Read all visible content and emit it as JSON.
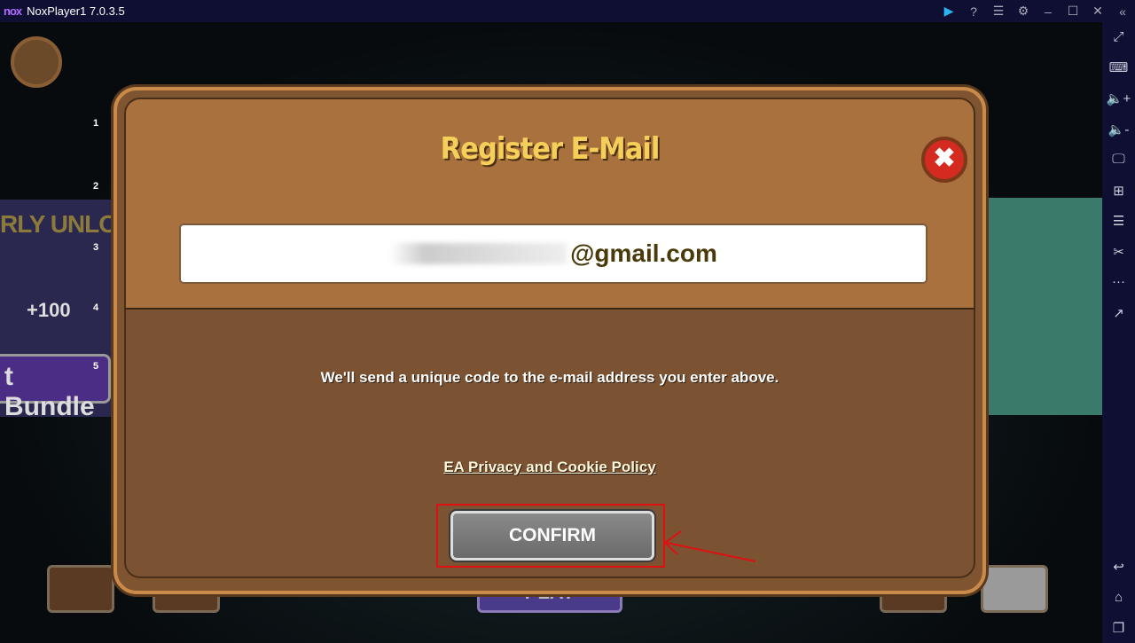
{
  "titlebar": {
    "logo": "nox",
    "title": "NoxPlayer1 7.0.3.5",
    "icons": [
      "play-store-icon",
      "help-icon",
      "menu-icon",
      "settings-icon",
      "minimize-icon",
      "maximize-icon",
      "close-icon",
      "collapse-icon"
    ]
  },
  "sidebar": {
    "icons": [
      "fullscreen-icon",
      "keyboard-icon",
      "volume-up-icon",
      "volume-down-icon",
      "screen-icon",
      "apk-install-icon",
      "multi-instance-icon",
      "screenshot-icon",
      "more-icon",
      "share-icon",
      "back-icon",
      "home-icon",
      "recent-apps-icon"
    ]
  },
  "game": {
    "numbers": [
      "1",
      "2",
      "3",
      "4",
      "5"
    ],
    "banner_text": "RLY UNLOCK",
    "banner_plus": "+100",
    "banner_button": "t Bundle",
    "play_label": "PLAY"
  },
  "dialog": {
    "title": "Register E-Mail",
    "email_suffix": "@gmail.com",
    "info": "We'll send a unique code to the e-mail address you enter above.",
    "policy_link": "EA Privacy and Cookie Policy",
    "confirm_label": "CONFIRM",
    "close_symbol": "✖"
  },
  "colors": {
    "title": "#f6cf5a",
    "highlight": "#e01010",
    "dialog_bg": "#7e5431"
  }
}
